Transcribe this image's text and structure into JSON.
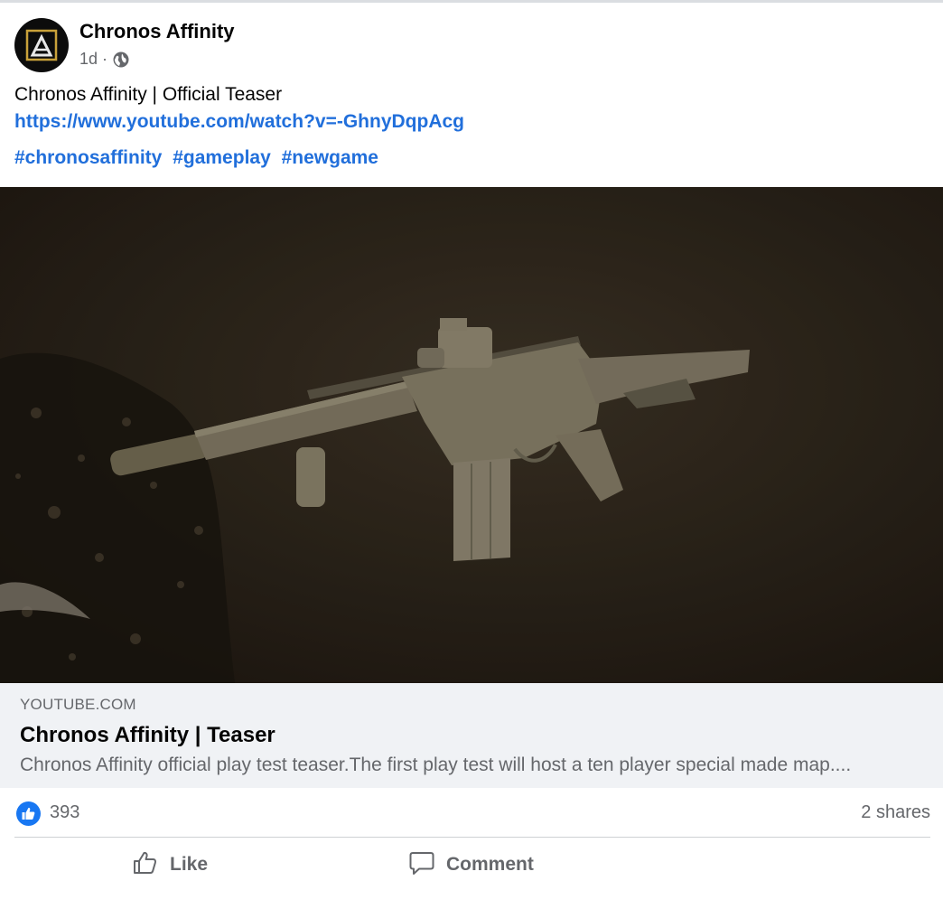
{
  "post": {
    "author": "Chronos Affinity",
    "time": "1d",
    "separator": "·",
    "audience_icon": "globe-icon",
    "text": "Chronos Affinity | Official Teaser",
    "link": "https://www.youtube.com/watch?v=-GhnyDqpAcg",
    "hashtags": [
      "#chronosaffinity",
      "#gameplay",
      "#newgame"
    ]
  },
  "preview": {
    "domain": "YOUTUBE.COM",
    "title": "Chronos Affinity | Teaser",
    "description": "Chronos Affinity official play test teaser.The first play test will host a ten player special made map...."
  },
  "stats": {
    "likes": "393",
    "shares": "2 shares"
  },
  "actions": {
    "like_label": "Like",
    "comment_label": "Comment"
  },
  "colors": {
    "link": "#216fdb",
    "like_badge": "#1877f2",
    "muted_text": "#65676b",
    "preview_bg": "#f0f2f5"
  }
}
